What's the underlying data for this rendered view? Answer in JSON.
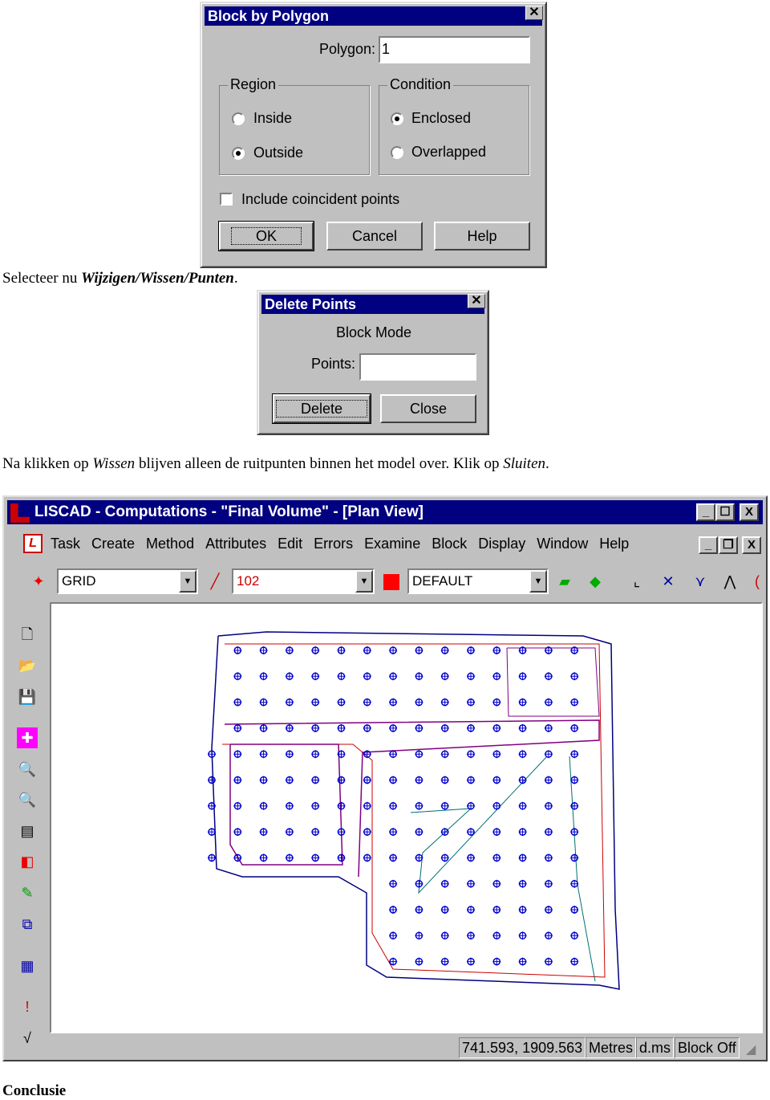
{
  "block_dialog": {
    "title": "Block by Polygon",
    "polygon_label": "Polygon:",
    "polygon_value": "1",
    "region": {
      "title": "Region",
      "options": [
        {
          "label": "Inside",
          "selected": false
        },
        {
          "label": "Outside",
          "selected": true
        }
      ]
    },
    "condition": {
      "title": "Condition",
      "options": [
        {
          "label": "Enclosed",
          "selected": true
        },
        {
          "label": "Overlapped",
          "selected": false
        }
      ]
    },
    "include_label": "Include coincident points",
    "include_checked": false,
    "ok": "OK",
    "cancel": "Cancel",
    "help": "Help"
  },
  "para1": {
    "text": "Selecteer nu ",
    "emph": "Wijzigen/Wissen/Punten",
    "end": "."
  },
  "delete_dialog": {
    "title": "Delete Points",
    "mode": "Block Mode",
    "points_label": "Points:",
    "points_value": "",
    "delete": "Delete",
    "close": "Close"
  },
  "para2": {
    "a": "Na klikken op ",
    "b": "Wissen",
    "c": " blijven alleen de ruitpunten binnen het model over. Klik op ",
    "d": "Sluiten",
    "e": "."
  },
  "app": {
    "title": "LISCAD - Computations - \"Final Volume\" - [Plan View]",
    "menu": [
      "Task",
      "Create",
      "Method",
      "Attributes",
      "Edit",
      "Errors",
      "Examine",
      "Block",
      "Display",
      "Window",
      "Help"
    ],
    "point_code": "GRID",
    "line_code": "102",
    "layer": "DEFAULT",
    "status": {
      "coords": "741.593, 1909.563",
      "units": "Metres",
      "angle": "d.ms",
      "block": "Block Off"
    },
    "colors": {
      "title": "#000080",
      "points": "#0000cc",
      "layer": "#ff0000"
    }
  },
  "heading": "Conclusie"
}
